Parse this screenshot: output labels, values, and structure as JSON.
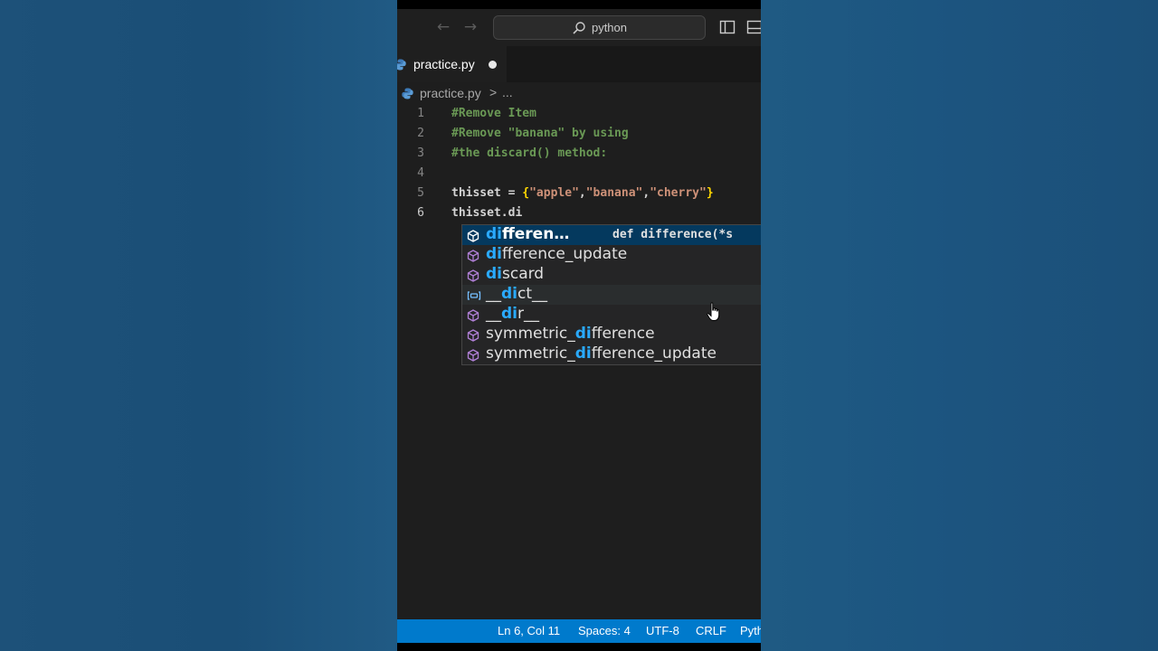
{
  "titlebar": {
    "search_text": "python"
  },
  "tab": {
    "filename": "practice.py"
  },
  "breadcrumb": {
    "file": "practice.py",
    "separator": ">",
    "more": "..."
  },
  "editor": {
    "lines": [
      {
        "num": "1",
        "text": "#Remove Item"
      },
      {
        "num": "2",
        "text": "#Remove \"banana\" by using"
      },
      {
        "num": "3",
        "text": "#the discard() method:"
      },
      {
        "num": "4",
        "text": ""
      },
      {
        "num": "5",
        "parts": [
          "thisset = ",
          "{",
          "\"apple\"",
          ",",
          "\"banana\"",
          ",",
          "\"cherry\"",
          "}"
        ]
      },
      {
        "num": "6",
        "text": "thisset.di"
      }
    ]
  },
  "suggestions": {
    "items": [
      {
        "match": "di",
        "rest": "fferen…",
        "pre": "",
        "icon": "method-icon",
        "detail": "def difference(*s"
      },
      {
        "match": "di",
        "rest": "fference_update",
        "pre": "",
        "icon": "method-icon"
      },
      {
        "match": "di",
        "rest": "scard",
        "pre": "",
        "icon": "method-icon"
      },
      {
        "pre": "__",
        "match": "di",
        "rest": "ct__",
        "icon": "variable-icon"
      },
      {
        "pre": "__",
        "match": "di",
        "rest": "r__",
        "icon": "method-icon"
      },
      {
        "pre": "symmetric_",
        "match": "di",
        "rest": "fference",
        "icon": "method-icon"
      },
      {
        "pre": "symmetric_",
        "match": "di",
        "rest": "fference_update",
        "icon": "method-icon"
      }
    ]
  },
  "statusbar": {
    "position": "Ln 6, Col 11",
    "spaces": "Spaces: 4",
    "encoding": "UTF-8",
    "eol": "CRLF",
    "language": "Pyth"
  },
  "colors": {
    "accent": "#007acc",
    "comment": "#6a9955",
    "string": "#ce9178",
    "bracket": "#ffd700",
    "match_highlight": "#2aaaff",
    "selected_row": "#04395e"
  }
}
